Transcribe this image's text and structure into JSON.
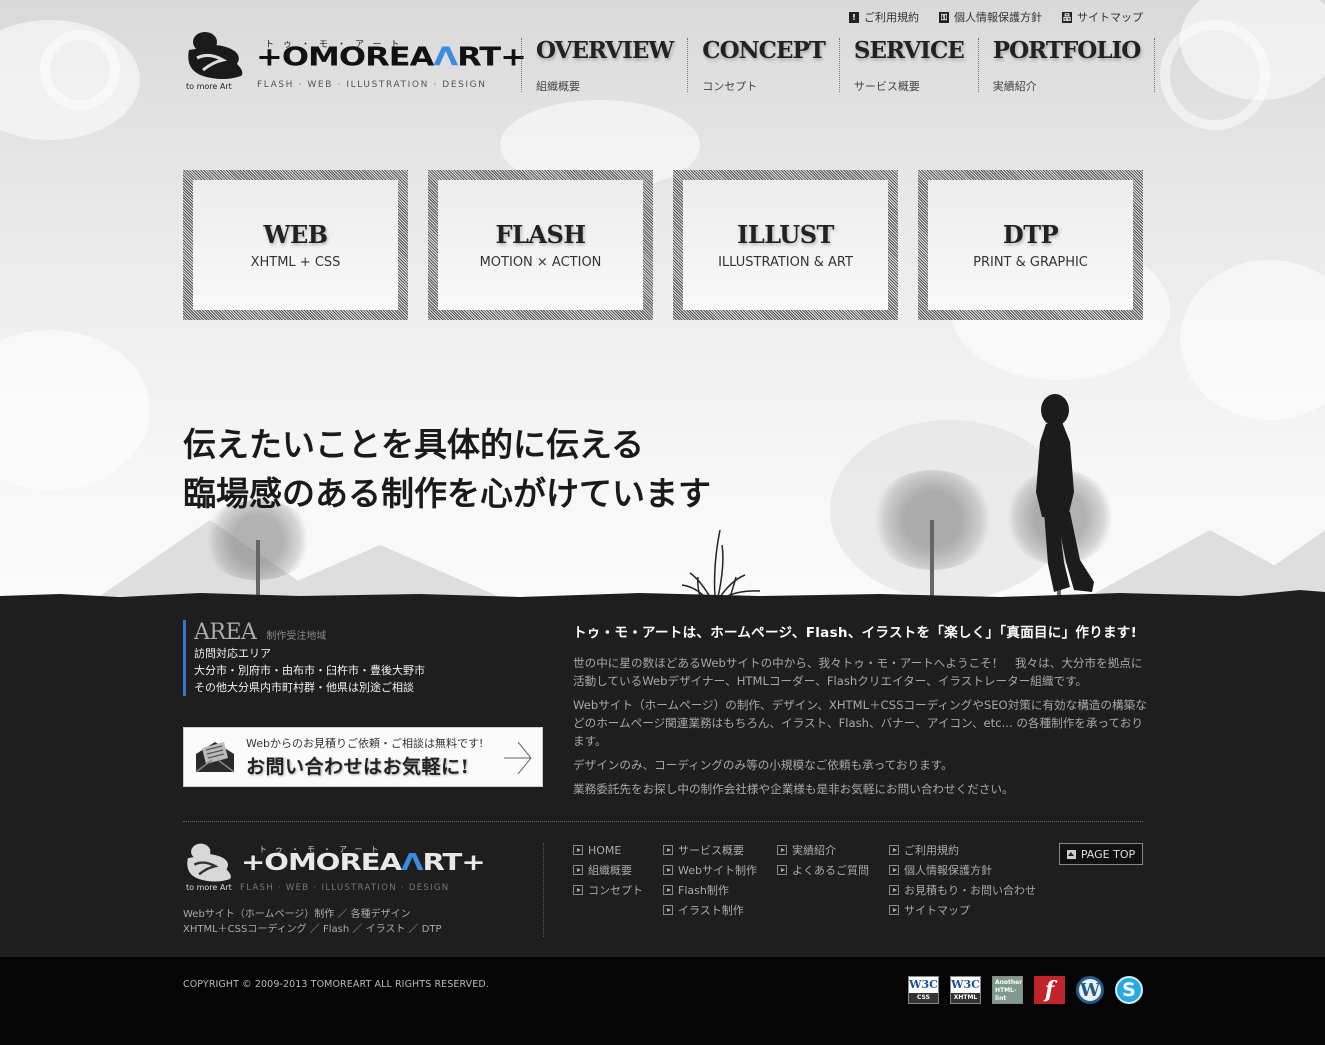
{
  "header": {
    "logo": {
      "kana": "トゥ・モ・アート",
      "word_main": "+OMOREA",
      "word_accent": "A",
      "word_tail": "RT+",
      "mark_caption": "to more Art",
      "tagline": "FLASH · WEB · ILLUSTRATION · DESIGN"
    },
    "util_links": [
      {
        "label": "ご利用規約",
        "icon": "terms-icon"
      },
      {
        "label": "個人情報保護方針",
        "icon": "privacy-key-icon"
      },
      {
        "label": "サイトマップ",
        "icon": "sitemap-icon"
      }
    ],
    "nav": [
      {
        "title": "OVERVIEW",
        "sub": "組織概要"
      },
      {
        "title": "CONCEPT",
        "sub": "コンセプト"
      },
      {
        "title": "SERVICE",
        "sub": "サービス概要"
      },
      {
        "title": "PORTFOLIO",
        "sub": "実績紹介"
      }
    ]
  },
  "services": [
    {
      "title": "WEB",
      "sub": "XHTML + CSS"
    },
    {
      "title": "FLASH",
      "sub": "MOTION × ACTION"
    },
    {
      "title": "ILLUST",
      "sub": "ILLUSTRATION & ART"
    },
    {
      "title": "DTP",
      "sub": "PRINT & GRAPHIC"
    }
  ],
  "catch": {
    "line1": "伝えたいことを具体的に伝える",
    "line2": "臨場感のある制作を心がけています"
  },
  "area": {
    "heading": "AREA",
    "heading_sub": "制作受注地域",
    "lines": [
      "訪問対応エリア",
      "大分市・別府市・由布市・臼杵市・豊後大野市",
      "その他大分県内市町村群・他県は別途ご相談"
    ]
  },
  "contact_banner": {
    "small": "Webからのお見積りご依頼・ご相談は無料です!",
    "big": "お問い合わせはお気軽に!"
  },
  "intro": {
    "heading": "トゥ・モ・アートは、ホームページ、Flash、イラストを「楽しく」「真面目に」作ります!",
    "paragraphs": [
      "世の中に星の数ほどあるWebサイトの中から、我々トゥ・モ・アートへようこそ！　我々は、大分市を拠点に活動しているWebデザイナー、HTMLコーダー、Flashクリエイター、イラストレーター組織です。",
      "Webサイト（ホームページ）の制作、デザイン、XHTML＋CSSコーディングやSEO対策に有効な構造の構築などのホームページ関連業務はもちろん、イラスト、Flash、バナー、アイコン、etc... の各種制作を承っております。",
      "デザインのみ、コーディングのみ等の小規模なご依頼も承っております。",
      "業務委託先をお探し中の制作会社様や企業様も是非お気軽にお問い合わせください。"
    ]
  },
  "footer": {
    "text_lines": [
      "Webサイト（ホームページ）制作 ／ 各種デザイン",
      "XHTML＋CSSコーディング ／ Flash ／ イラスト ／ DTP"
    ],
    "nav_columns": [
      [
        "HOME",
        "組織概要",
        "コンセプト"
      ],
      [
        "サービス概要",
        "Webサイト制作",
        "Flash制作",
        "イラスト制作"
      ],
      [
        "実績紹介",
        "よくあるご質問"
      ],
      [
        "ご利用規約",
        "個人情報保護方針",
        "お見積もり・お問い合わせ",
        "サイトマップ"
      ]
    ],
    "page_top": "PAGE TOP",
    "copyright": "COPYRIGHT © 2009-2013 TOMOREART ALL RIGHTS RESERVED.",
    "badges": [
      {
        "name": "w3c-css-badge",
        "top": "W3C",
        "bottom": "CSS"
      },
      {
        "name": "w3c-xhtml-badge",
        "top": "W3C",
        "bottom": "XHTML"
      },
      {
        "name": "another-html-lint-badge",
        "text": "Another HTML-lint"
      },
      {
        "name": "flash-icon",
        "text": "f"
      },
      {
        "name": "wordpress-icon",
        "text": "W"
      },
      {
        "name": "skype-icon",
        "text": "S"
      }
    ]
  },
  "colors": {
    "accent_blue": "#2f78d1",
    "dark_bg": "#1e1e1e",
    "bottom_bg": "#050505",
    "flash_red": "#c0232a",
    "skype_blue": "#28a9e2",
    "wordpress_blue": "#1f5d8a"
  }
}
